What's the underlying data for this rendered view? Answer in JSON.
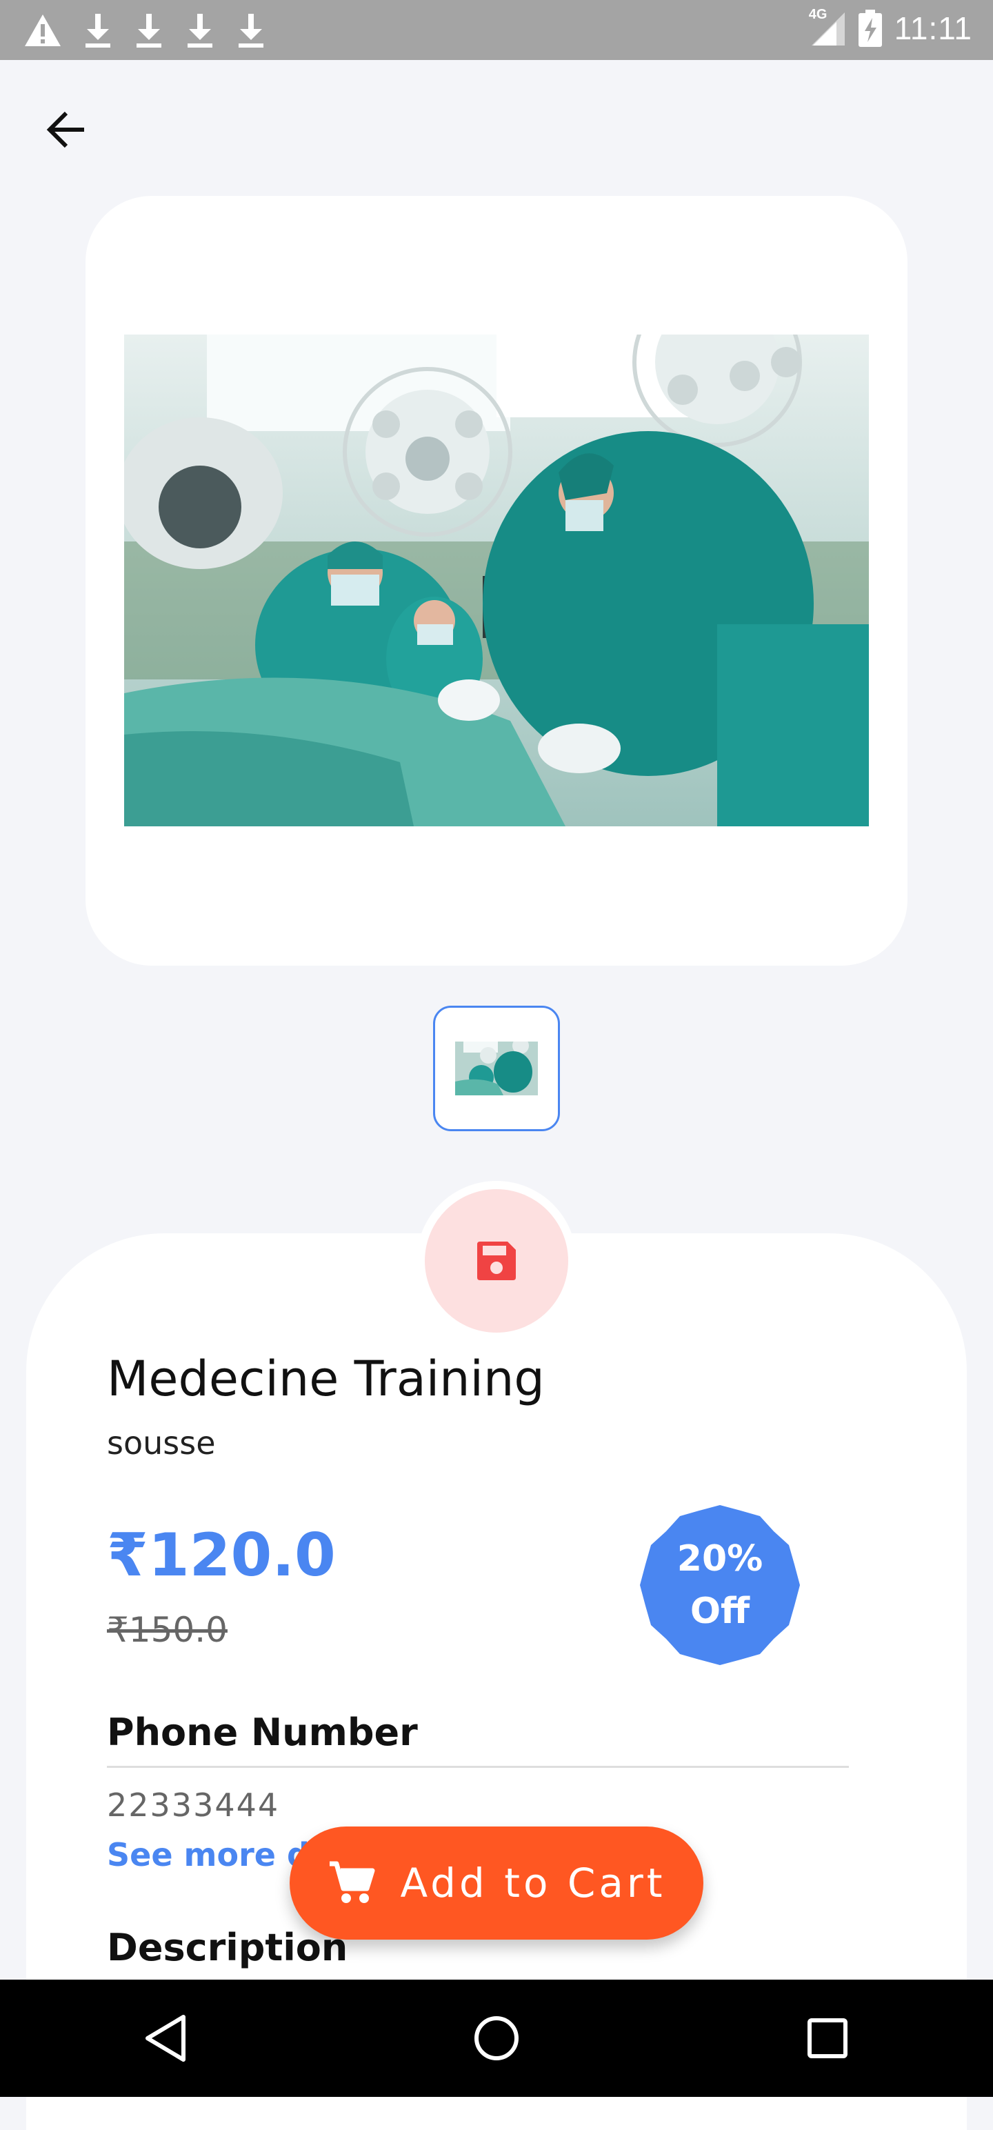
{
  "status_bar": {
    "time": "11:11",
    "network": "4G",
    "notification_icons": [
      "warning-icon",
      "download-icon",
      "download-icon",
      "download-icon",
      "download-icon"
    ]
  },
  "header": {
    "back_icon": "arrow-left-icon"
  },
  "product": {
    "title": "Medecine Training",
    "location": "sousse",
    "price": "₹120.0",
    "original_price": "₹150.0",
    "discount_line1": "20%",
    "discount_line2": "Off",
    "phone_label": "Phone Number",
    "phone_value": "22333444",
    "see_more_label": "See more d",
    "description_label": "Description"
  },
  "actions": {
    "add_to_cart_label": "Add to Cart",
    "save_icon": "save-icon"
  },
  "colors": {
    "accent": "#4a86f1",
    "cart_button": "#ff5722",
    "save_icon": "#f04343",
    "save_bg": "#fde0e0",
    "page_bg": "#f4f5f9"
  },
  "nav_bar": {
    "items": [
      "back-icon",
      "home-icon",
      "recents-icon"
    ]
  }
}
